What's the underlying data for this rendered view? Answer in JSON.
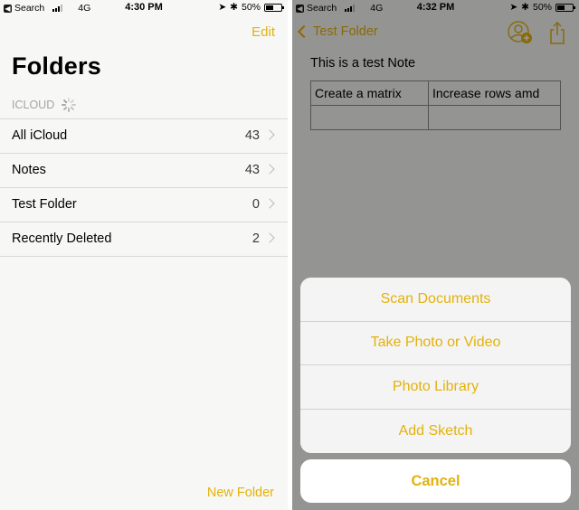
{
  "left_screen": {
    "status": {
      "back_app": "Search",
      "network": "4G",
      "time": "4:30 PM",
      "battery": "50%",
      "battery_level": 0.5
    },
    "edit_label": "Edit",
    "title": "Folders",
    "section_label": "ICLOUD",
    "folders": [
      {
        "name": "All iCloud",
        "count": "43"
      },
      {
        "name": "Notes",
        "count": "43"
      },
      {
        "name": "Test Folder",
        "count": "0"
      },
      {
        "name": "Recently Deleted",
        "count": "2"
      }
    ],
    "new_folder_label": "New Folder"
  },
  "right_screen": {
    "status": {
      "back_app": "Search",
      "network": "4G",
      "time": "4:32 PM",
      "battery": "50%",
      "battery_level": 0.5
    },
    "back_label": "Test Folder",
    "note_title": "This is a test Note",
    "table": [
      [
        "Create a matrix",
        "Increase rows amd"
      ],
      [
        "",
        ""
      ]
    ],
    "actions": [
      "Scan Documents",
      "Take Photo or Video",
      "Photo Library",
      "Add Sketch"
    ],
    "cancel_label": "Cancel"
  },
  "colors": {
    "accent": "#e3b20c",
    "background": "#f7f7f5",
    "separator": "#d9d9d7"
  }
}
